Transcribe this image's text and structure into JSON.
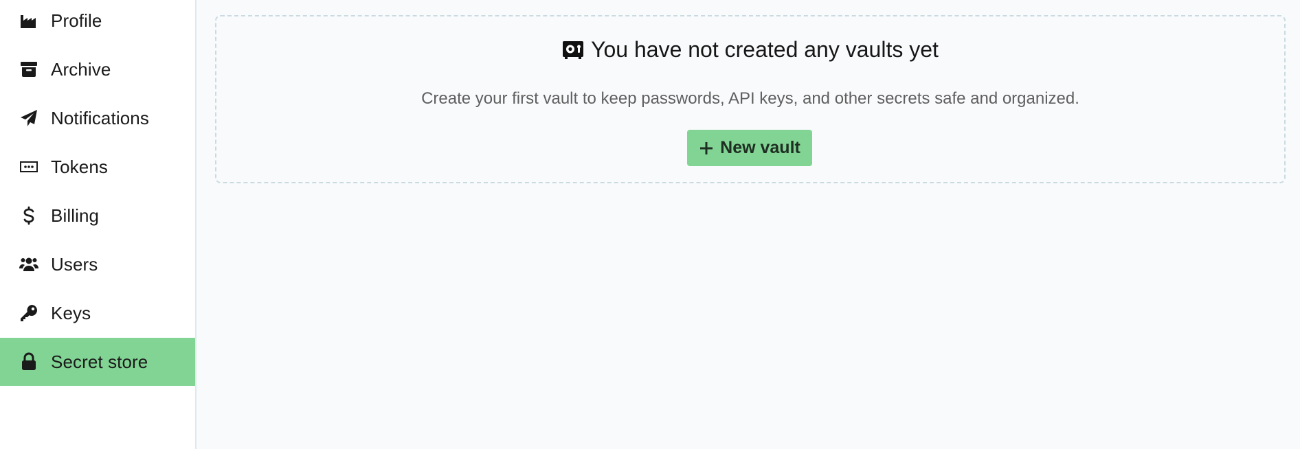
{
  "sidebar": {
    "items": [
      {
        "label": "Profile",
        "icon": "industry-icon",
        "active": false
      },
      {
        "label": "Archive",
        "icon": "archive-icon",
        "active": false
      },
      {
        "label": "Notifications",
        "icon": "paper-plane-icon",
        "active": false
      },
      {
        "label": "Tokens",
        "icon": "token-icon",
        "active": false
      },
      {
        "label": "Billing",
        "icon": "dollar-icon",
        "active": false
      },
      {
        "label": "Users",
        "icon": "users-icon",
        "active": false
      },
      {
        "label": "Keys",
        "icon": "key-icon",
        "active": false
      },
      {
        "label": "Secret store",
        "icon": "lock-icon",
        "active": true
      }
    ]
  },
  "main": {
    "empty_state": {
      "icon": "vault-icon",
      "title": "You have not created any vaults yet",
      "description": "Create your first vault to keep passwords, API keys, and other secrets safe and organized.",
      "button_label": "New vault",
      "button_icon": "plus-icon"
    }
  },
  "colors": {
    "accent": "#82d494",
    "background": "#f9fafc"
  }
}
